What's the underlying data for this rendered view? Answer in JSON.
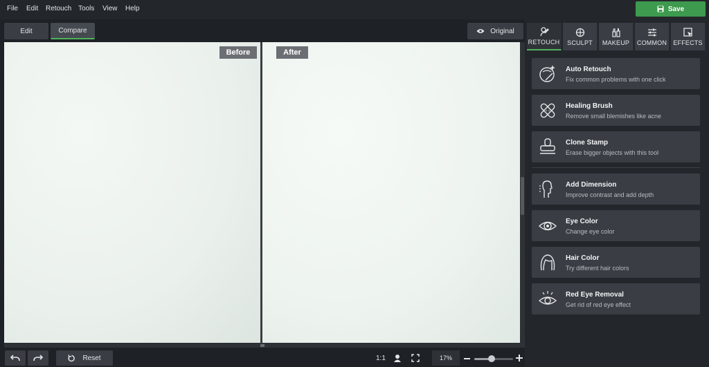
{
  "menu": {
    "items": [
      "File",
      "Edit",
      "Retouch",
      "Tools",
      "View",
      "Help"
    ],
    "save_label": "Save"
  },
  "toolbar": {
    "edit_label": "Edit",
    "compare_label": "Compare",
    "original_label": "Original"
  },
  "canvas": {
    "before_label": "Before",
    "after_label": "After"
  },
  "bottom": {
    "reset_label": "Reset",
    "ratio_label": "1:1",
    "zoom_value": "17%",
    "zoom_level": 0.45
  },
  "panel": {
    "tabs": [
      {
        "label": "RETOUCH",
        "icon": "retouch-icon"
      },
      {
        "label": "SCULPT",
        "icon": "sculpt-icon"
      },
      {
        "label": "MAKEUP",
        "icon": "makeup-icon"
      },
      {
        "label": "COMMON",
        "icon": "common-icon"
      },
      {
        "label": "EFFECTS",
        "icon": "effects-icon"
      }
    ],
    "tools": [
      {
        "title": "Auto Retouch",
        "desc": "Fix common problems with one click",
        "icon": "auto-retouch-icon"
      },
      {
        "title": "Healing Brush",
        "desc": "Remove small blemishes like acne",
        "icon": "healing-brush-icon"
      },
      {
        "title": "Clone Stamp",
        "desc": "Erase bigger objects with this tool",
        "icon": "clone-stamp-icon"
      },
      {
        "title": "Add Dimension",
        "desc": "Improve contrast and add depth",
        "icon": "add-dimension-icon"
      },
      {
        "title": "Eye Color",
        "desc": "Change eye color",
        "icon": "eye-color-icon"
      },
      {
        "title": "Hair Color",
        "desc": "Try different hair colors",
        "icon": "hair-color-icon"
      },
      {
        "title": "Red Eye Removal",
        "desc": "Get rid of red eye effect",
        "icon": "red-eye-icon"
      }
    ]
  },
  "colors": {
    "accent": "#4fb35d",
    "save_button": "#3e9a4e",
    "panel_bg": "#23272c",
    "card_bg": "#3a3e44"
  }
}
